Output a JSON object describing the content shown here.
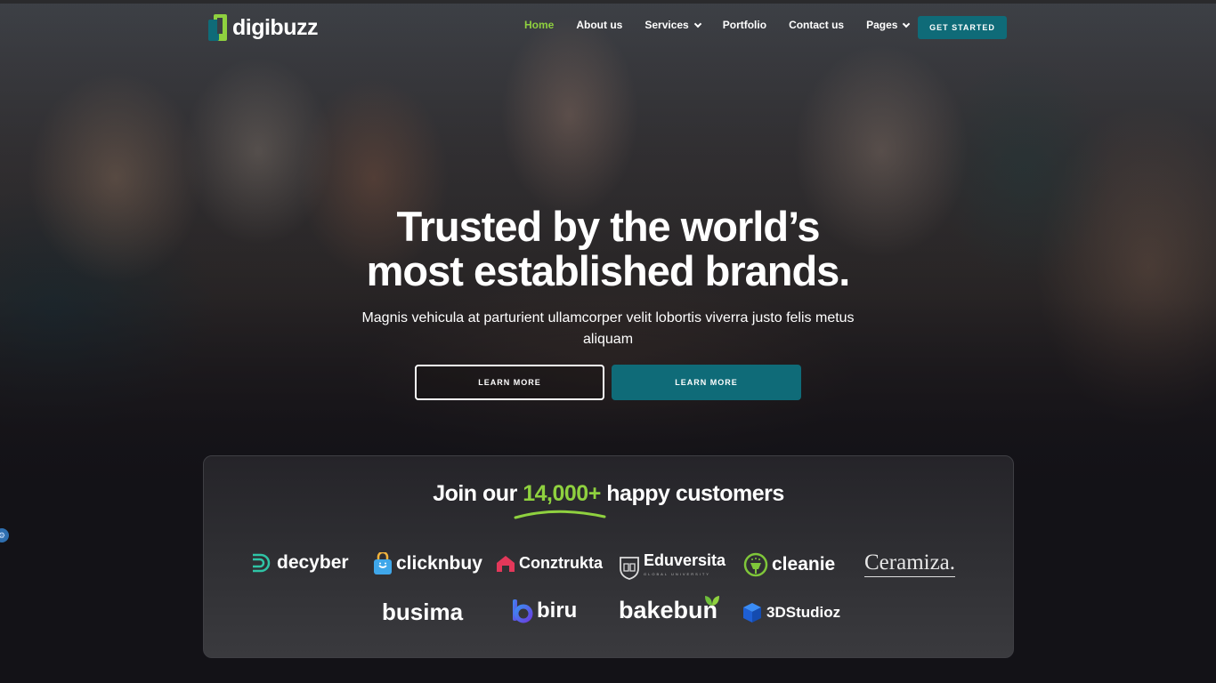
{
  "brand": {
    "name": "digibuzz",
    "accent": "#8fd13f",
    "primary": "#0f6b78"
  },
  "nav": {
    "items": [
      {
        "label": "Home",
        "active": true,
        "dropdown": false
      },
      {
        "label": "About us",
        "active": false,
        "dropdown": false
      },
      {
        "label": "Services",
        "active": false,
        "dropdown": true
      },
      {
        "label": "Portfolio",
        "active": false,
        "dropdown": false
      },
      {
        "label": "Contact us",
        "active": false,
        "dropdown": false
      },
      {
        "label": "Pages",
        "active": false,
        "dropdown": true
      }
    ],
    "cta": "GET STARTED"
  },
  "hero": {
    "title_line1": "Trusted by the world’s",
    "title_line2": "most established brands.",
    "subtitle": "Magnis vehicula at parturient ullamcorper velit lobortis viverra justo felis metus aliquam",
    "button_outline": "LEARN MORE",
    "button_solid": "LEARN MORE"
  },
  "customers": {
    "title_prefix": "Join our",
    "title_highlight": "14,000+",
    "title_suffix": "happy customers",
    "logos": [
      {
        "name": "decyber",
        "icon": "decyber-d-icon"
      },
      {
        "name": "clicknbuy",
        "icon": "shopping-bag-icon"
      },
      {
        "name": "Conztrukta",
        "icon": "house-roof-icon"
      },
      {
        "name": "Eduversita",
        "subtitle": "GLOBAL UNIVERSITY",
        "icon": "shield-book-icon"
      },
      {
        "name": "cleanie",
        "icon": "broom-circle-icon"
      },
      {
        "name": "Ceramiza.",
        "icon": ""
      },
      {
        "name": "busima",
        "icon": ""
      },
      {
        "name": "biru",
        "icon": "biru-b-icon"
      },
      {
        "name": "bakebun",
        "icon": "leaf-icon"
      },
      {
        "name": "3DStudioz",
        "icon": "cube-icon"
      }
    ]
  },
  "side_widget": {
    "icon": "accessibility-icon",
    "glyph": "⚙"
  }
}
